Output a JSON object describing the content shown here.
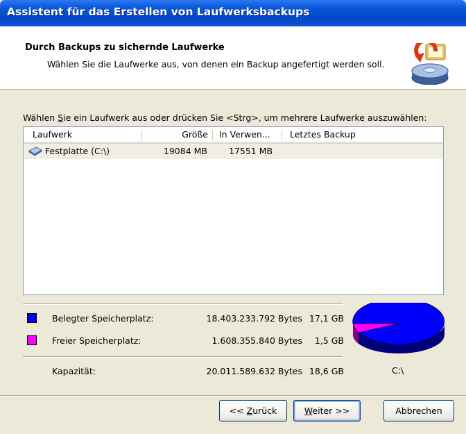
{
  "window": {
    "title": "Assistent für das Erstellen von Laufwerksbackups"
  },
  "header": {
    "title": "Durch Backups zu sichernde Laufwerke",
    "subtitle": "Wählen Sie die Laufwerke aus, von denen ein Backup angefertigt werden soll.",
    "icon": "backup-drive-icon"
  },
  "instruction": {
    "before": "Wählen ",
    "underlined": "S",
    "after": "ie ein Laufwerk aus oder drücken Sie <Strg>, um mehrere Laufwerke auszuwählen:"
  },
  "drive_list": {
    "columns": [
      "Laufwerk",
      "Größe",
      "In Verwen...",
      "Letztes Backup"
    ],
    "rows": [
      {
        "icon": "hard-disk-icon",
        "name": "Festplatte (C:\\)",
        "size": "19084 MB",
        "used": "17551 MB",
        "last_backup": ""
      }
    ]
  },
  "stats": {
    "used": {
      "label": "Belegter Speicherplatz:",
      "bytes": "18.403.233.792 Bytes",
      "gb": "17,1 GB",
      "color": "#0000ff"
    },
    "free": {
      "label": "Freier Speicherplatz:",
      "bytes": "1.608.355.840 Bytes",
      "gb": "1,5 GB",
      "color": "#ff00ff"
    },
    "capacity": {
      "label": "Kapazität:",
      "bytes": "20.011.589.632 Bytes",
      "gb": "18,6 GB"
    },
    "drive_letter": "C:\\",
    "used_fraction": 0.92
  },
  "buttons": {
    "back": {
      "prefix": "<< ",
      "underlined": "Z",
      "rest": "urück"
    },
    "next": {
      "underlined": "W",
      "rest": "eiter >>"
    },
    "cancel": "Abbrechen"
  }
}
